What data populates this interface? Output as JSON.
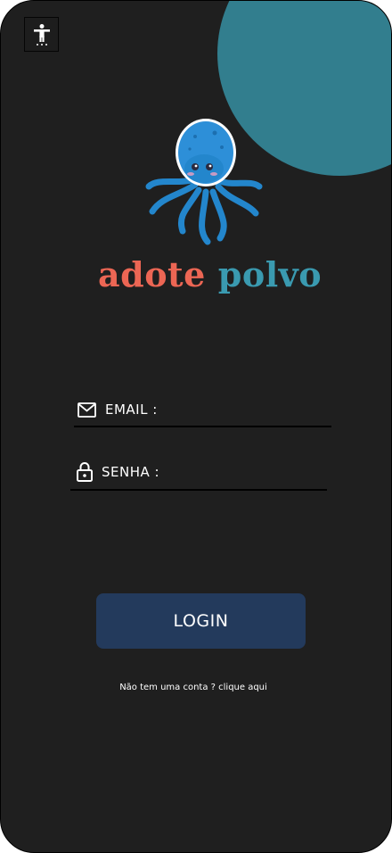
{
  "brand": {
    "word1": "adote",
    "word2": "polvo"
  },
  "form": {
    "email_label": "EMAIL :",
    "password_label": "SENHA :",
    "login_label": "LOGIN",
    "signup_text": "Não tem uma conta ? clique aqui"
  },
  "icons": {
    "accessibility": "accessibility-icon",
    "email": "envelope-icon",
    "password": "lock-icon",
    "logo": "octopus-icon"
  },
  "colors": {
    "background": "#1f1f1f",
    "accent_circle": "#327e8e",
    "brand_red": "#ec6654",
    "brand_teal": "#3a9ab0",
    "button": "#233a5c",
    "text": "#ffffff"
  }
}
